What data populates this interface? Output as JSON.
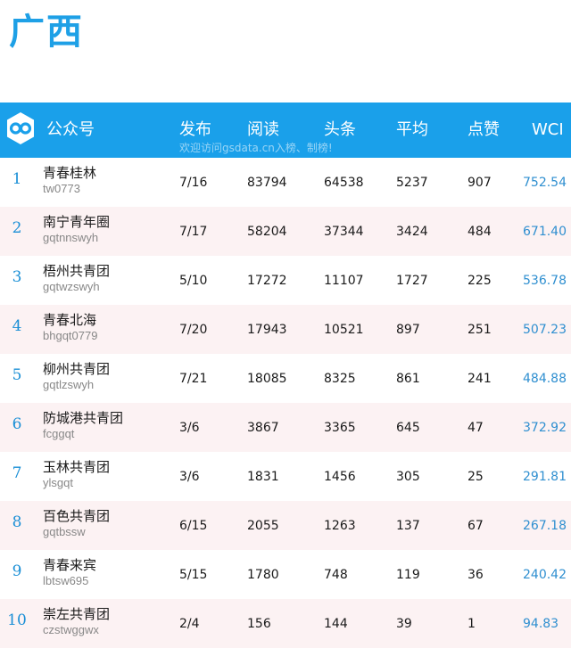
{
  "title": "广西",
  "header": {
    "account": "公众号",
    "publish": "发布",
    "read": "阅读",
    "top": "头条",
    "avg": "平均",
    "like": "点赞",
    "wci": "WCI",
    "subtitle": "欢迎访问gsdata.cn入榜、制榜!"
  },
  "colors": {
    "accent": "#1aa0ea",
    "wci": "#2f8fd0",
    "rank": "#1a8fd6",
    "alt_row": "#fcf2f3"
  },
  "rows": [
    {
      "rank": "1",
      "name": "青春桂林",
      "id": "tw0773",
      "publish": "7/16",
      "read": "83794",
      "top": "64538",
      "avg": "5237",
      "like": "907",
      "wci": "752.54"
    },
    {
      "rank": "2",
      "name": "南宁青年圈",
      "id": "gqtnnswyh",
      "publish": "7/17",
      "read": "58204",
      "top": "37344",
      "avg": "3424",
      "like": "484",
      "wci": "671.40"
    },
    {
      "rank": "3",
      "name": "梧州共青团",
      "id": "gqtwzswyh",
      "publish": "5/10",
      "read": "17272",
      "top": "11107",
      "avg": "1727",
      "like": "225",
      "wci": "536.78"
    },
    {
      "rank": "4",
      "name": "青春北海",
      "id": "bhgqt0779",
      "publish": "7/20",
      "read": "17943",
      "top": "10521",
      "avg": "897",
      "like": "251",
      "wci": "507.23"
    },
    {
      "rank": "5",
      "name": "柳州共青团",
      "id": "gqtlzswyh",
      "publish": "7/21",
      "read": "18085",
      "top": "8325",
      "avg": "861",
      "like": "241",
      "wci": "484.88"
    },
    {
      "rank": "6",
      "name": "防城港共青团",
      "id": "fcggqt",
      "publish": "3/6",
      "read": "3867",
      "top": "3365",
      "avg": "645",
      "like": "47",
      "wci": "372.92"
    },
    {
      "rank": "7",
      "name": "玉林共青团",
      "id": "ylsgqt",
      "publish": "3/6",
      "read": "1831",
      "top": "1456",
      "avg": "305",
      "like": "25",
      "wci": "291.81"
    },
    {
      "rank": "8",
      "name": "百色共青团",
      "id": "gqtbssw",
      "publish": "6/15",
      "read": "2055",
      "top": "1263",
      "avg": "137",
      "like": "67",
      "wci": "267.18"
    },
    {
      "rank": "9",
      "name": "青春来宾",
      "id": "lbtsw695",
      "publish": "5/15",
      "read": "1780",
      "top": "748",
      "avg": "119",
      "like": "36",
      "wci": "240.42"
    },
    {
      "rank": "10",
      "name": "崇左共青团",
      "id": "czstwggwx",
      "publish": "2/4",
      "read": "156",
      "top": "144",
      "avg": "39",
      "like": "1",
      "wci": "94.83"
    }
  ]
}
